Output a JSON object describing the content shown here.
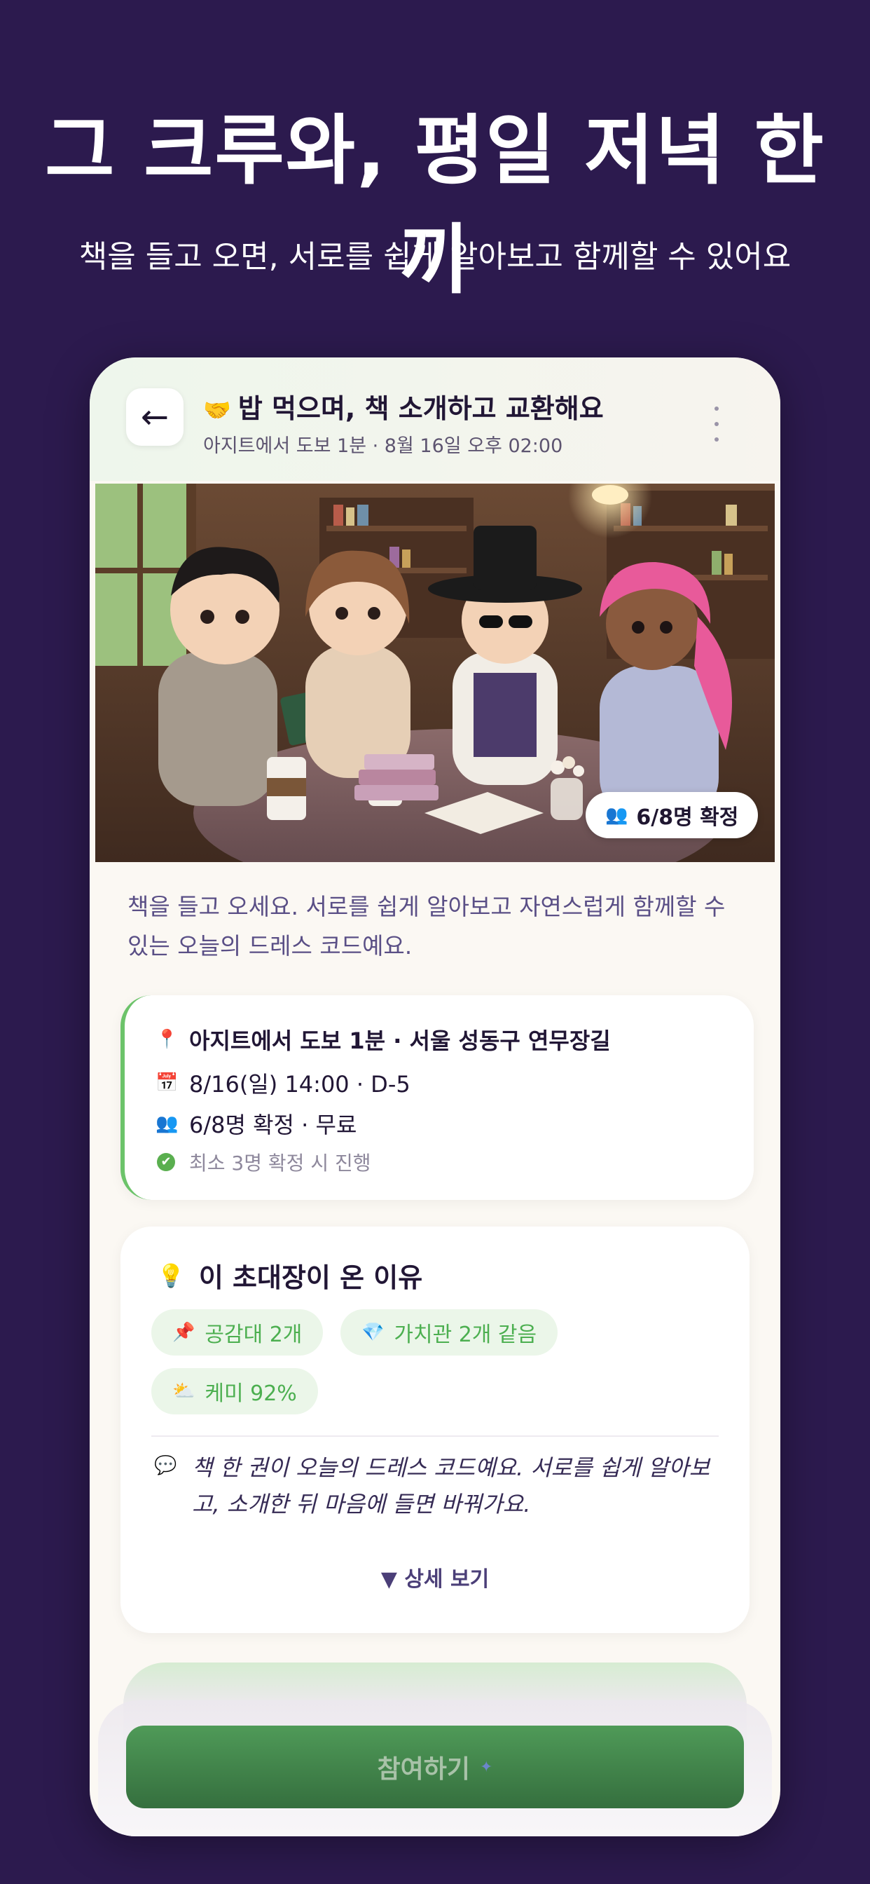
{
  "promo": {
    "headline": "그 크루와, 평일 저녁 한 끼",
    "subline": "책을 들고 오면, 서로를 쉽게 알아보고 함께할 수 있어요"
  },
  "appbar": {
    "back_icon": "←",
    "title_emoji": "🤝",
    "title": "밥 먹으며, 책 소개하고 교환해요",
    "subtitle": "아지트에서 도보 1분 · 8월 16일 오후 02:00"
  },
  "hero": {
    "count_emoji": "👥",
    "count_label": "6/8명 확정"
  },
  "description": "책을 들고 오세요. 서로를 쉽게 알아보고 자연스럽게 함께할 수 있는 오늘의 드레스 코드예요.",
  "info": {
    "location_icon": "📍",
    "location": "아지트에서 도보 1분 · 서울 성동구 연무장길",
    "date_icon": "📅",
    "date": "8/16(일) 14:00 · D-5",
    "people_icon": "👥",
    "people": "6/8명 확정 · 무료",
    "check_icon": "✔",
    "rule": "최소 3명 확정 시 진행"
  },
  "reason": {
    "title_icon": "💡",
    "title": "이 초대장이 온 이유",
    "chips": [
      {
        "icon": "📌",
        "label": "공감대 2개"
      },
      {
        "icon": "💎",
        "label": "가치관 2개 같음"
      },
      {
        "icon": "⛅",
        "label": "케미 92%"
      }
    ],
    "quote_icon": "💬",
    "quote": "책 한 권이 오늘의 드레스 코드예요. 서로를 쉽게 알아보고, 소개한 뒤 마음에 들면 바꿔가요.",
    "detail_link": "▼ 상세 보기"
  },
  "cta": {
    "label": "참여하기",
    "spark_icon": "✦"
  },
  "colors": {
    "background": "#2c1a4e",
    "accent_green": "#4caf50",
    "button_green": "#3f8449"
  }
}
